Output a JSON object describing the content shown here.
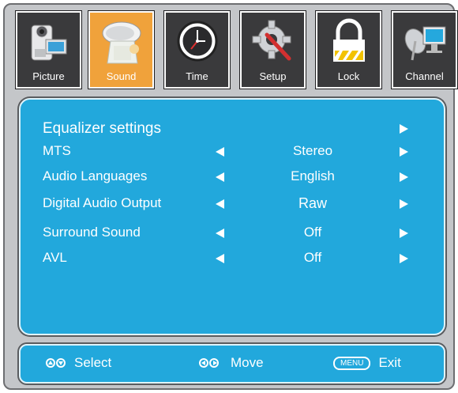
{
  "tabs": [
    {
      "label": "Picture",
      "icon": "camcorder-icon",
      "active": false
    },
    {
      "label": "Sound",
      "icon": "speaker-icon",
      "active": true
    },
    {
      "label": "Time",
      "icon": "clock-icon",
      "active": false
    },
    {
      "label": "Setup",
      "icon": "gear-icon",
      "active": false
    },
    {
      "label": "Lock",
      "icon": "padlock-icon",
      "active": false
    },
    {
      "label": "Channel",
      "icon": "satellite-dish-icon",
      "active": false
    }
  ],
  "menu": {
    "rows": [
      {
        "label": "Equalizer settings",
        "value": ""
      },
      {
        "label": "MTS",
        "value": "Stereo"
      },
      {
        "label": "Audio Languages",
        "value": "English"
      },
      {
        "label": "Digital Audio Output",
        "value": "Raw"
      },
      {
        "label": "Surround Sound",
        "value": "Off"
      },
      {
        "label": "AVL",
        "value": "Off"
      }
    ]
  },
  "footer": {
    "select_label": "Select",
    "move_label": "Move",
    "menu_key": "MENU",
    "exit_label": "Exit"
  },
  "colors": {
    "panel": "#22a8dc",
    "active_tab": "#f0a23b",
    "tab": "#3a3a3c",
    "frame": "#c4c6c9"
  }
}
